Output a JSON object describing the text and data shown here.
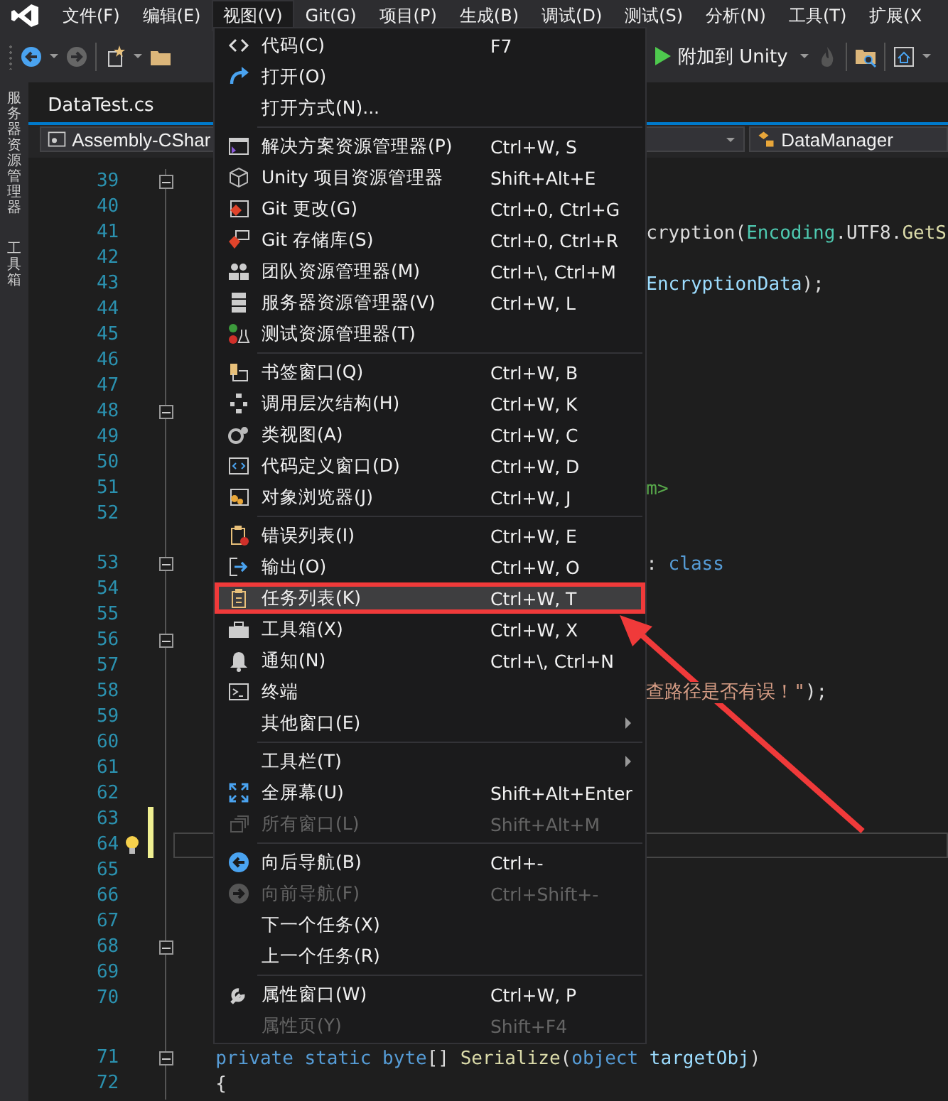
{
  "menubar": [
    {
      "label": "文件(F)",
      "selected": false
    },
    {
      "label": "编辑(E)",
      "selected": false
    },
    {
      "label": "视图(V)",
      "selected": true
    },
    {
      "label": "Git(G)",
      "selected": false
    },
    {
      "label": "项目(P)",
      "selected": false
    },
    {
      "label": "生成(B)",
      "selected": false
    },
    {
      "label": "调试(D)",
      "selected": false
    },
    {
      "label": "测试(S)",
      "selected": false
    },
    {
      "label": "分析(N)",
      "selected": false
    },
    {
      "label": "工具(T)",
      "selected": false
    },
    {
      "label": "扩展(X",
      "selected": false
    }
  ],
  "toolbar": {
    "attach_label": "附加到 Unity"
  },
  "side_tabs": [
    "服务器资源管理器",
    "工具箱"
  ],
  "tabs": [
    {
      "label": "DataTest.cs",
      "selected": true
    }
  ],
  "nav": {
    "project": "Assembly-CShar",
    "member": "DataManager"
  },
  "editor": {
    "lines": [
      {
        "kind": "blank",
        "number": "39",
        "foldable": true,
        "modified": false,
        "lightbulb": false,
        "current": false
      },
      {
        "kind": "blank",
        "number": "40",
        "foldable": false,
        "modified": false,
        "lightbulb": false,
        "current": false
      },
      {
        "kind": "clipped",
        "number": "41",
        "foldable": false,
        "modified": false,
        "lightbulb": false,
        "current": false,
        "tokens": [
          {
            "text": "cryption(",
            "kind": "plain"
          },
          {
            "text": "Encoding",
            "kind": "type"
          },
          {
            "text": ".UTF8.",
            "kind": "plain"
          },
          {
            "text": "GetS",
            "kind": "method"
          }
        ]
      },
      {
        "kind": "blank",
        "number": "42",
        "foldable": false,
        "modified": false,
        "lightbulb": false,
        "current": false
      },
      {
        "kind": "clipped",
        "number": "43",
        "foldable": false,
        "modified": false,
        "lightbulb": false,
        "current": false,
        "tokens": [
          {
            "text": "EncryptionData",
            "kind": "variable"
          },
          {
            "text": ");",
            "kind": "plain"
          }
        ]
      },
      {
        "kind": "blank",
        "number": "44",
        "foldable": false,
        "modified": false,
        "lightbulb": false,
        "current": false
      },
      {
        "kind": "blank",
        "number": "45",
        "foldable": false,
        "modified": false,
        "lightbulb": false,
        "current": false
      },
      {
        "kind": "blank",
        "number": "46",
        "foldable": false,
        "modified": false,
        "lightbulb": false,
        "current": false
      },
      {
        "kind": "blank",
        "number": "47",
        "foldable": false,
        "modified": false,
        "lightbulb": false,
        "current": false
      },
      {
        "kind": "blank",
        "number": "48",
        "foldable": true,
        "modified": false,
        "lightbulb": false,
        "current": false
      },
      {
        "kind": "blank",
        "number": "49",
        "foldable": false,
        "modified": false,
        "lightbulb": false,
        "current": false
      },
      {
        "kind": "blank",
        "number": "50",
        "foldable": false,
        "modified": false,
        "lightbulb": false,
        "current": false
      },
      {
        "kind": "clipped",
        "number": "51",
        "foldable": false,
        "modified": false,
        "lightbulb": false,
        "current": false,
        "tokens": [
          {
            "text": "m>",
            "kind": "comment"
          }
        ]
      },
      {
        "kind": "blank",
        "number": "52",
        "foldable": false,
        "modified": false,
        "lightbulb": false,
        "current": false
      },
      {
        "kind": "codelens"
      },
      {
        "kind": "clipped",
        "number": "53",
        "foldable": true,
        "modified": false,
        "lightbulb": false,
        "current": false,
        "tokens": [
          {
            "text": ": ",
            "kind": "plain"
          },
          {
            "text": "class",
            "kind": "keyword"
          }
        ]
      },
      {
        "kind": "blank",
        "number": "54",
        "foldable": false,
        "modified": false,
        "lightbulb": false,
        "current": false
      },
      {
        "kind": "blank",
        "number": "55",
        "foldable": false,
        "modified": false,
        "lightbulb": false,
        "current": false
      },
      {
        "kind": "blank",
        "number": "56",
        "foldable": true,
        "modified": false,
        "lightbulb": false,
        "current": false
      },
      {
        "kind": "blank",
        "number": "57",
        "foldable": false,
        "modified": false,
        "lightbulb": false,
        "current": false
      },
      {
        "kind": "clipped",
        "number": "58",
        "foldable": false,
        "modified": false,
        "lightbulb": false,
        "current": false,
        "tokens": [
          {
            "text": "查路径是否有误！\"",
            "kind": "string"
          },
          {
            "text": ");",
            "kind": "plain"
          }
        ]
      },
      {
        "kind": "blank",
        "number": "59",
        "foldable": false,
        "modified": false,
        "lightbulb": false,
        "current": false
      },
      {
        "kind": "blank",
        "number": "60",
        "foldable": false,
        "modified": false,
        "lightbulb": false,
        "current": false
      },
      {
        "kind": "blank",
        "number": "61",
        "foldable": false,
        "modified": false,
        "lightbulb": false,
        "current": false
      },
      {
        "kind": "blank",
        "number": "62",
        "foldable": false,
        "modified": false,
        "lightbulb": false,
        "current": false
      },
      {
        "kind": "blank",
        "number": "63",
        "foldable": false,
        "modified": true,
        "lightbulb": false,
        "current": false
      },
      {
        "kind": "blank",
        "number": "64",
        "foldable": false,
        "modified": true,
        "lightbulb": true,
        "current": true
      },
      {
        "kind": "blank",
        "number": "65",
        "foldable": false,
        "modified": false,
        "lightbulb": false,
        "current": false
      },
      {
        "kind": "blank",
        "number": "66",
        "foldable": false,
        "modified": false,
        "lightbulb": false,
        "current": false
      },
      {
        "kind": "blank",
        "number": "67",
        "foldable": false,
        "modified": false,
        "lightbulb": false,
        "current": false
      },
      {
        "kind": "blank",
        "number": "68",
        "foldable": true,
        "modified": false,
        "lightbulb": false,
        "current": false
      },
      {
        "kind": "blank",
        "number": "69",
        "foldable": false,
        "modified": false,
        "lightbulb": false,
        "current": false
      },
      {
        "kind": "blank",
        "number": "70",
        "foldable": false,
        "modified": false,
        "lightbulb": false,
        "current": false
      },
      {
        "kind": "codelens"
      },
      {
        "kind": "full",
        "number": "71",
        "foldable": true,
        "modified": false,
        "lightbulb": false,
        "current": false,
        "tokens": [
          {
            "text": "private static ",
            "kind": "keyword"
          },
          {
            "text": "byte",
            "kind": "keyword"
          },
          {
            "text": "[] ",
            "kind": "plain"
          },
          {
            "text": "Serialize",
            "kind": "method"
          },
          {
            "text": "(",
            "kind": "plain"
          },
          {
            "text": "object ",
            "kind": "keyword"
          },
          {
            "text": "targetObj",
            "kind": "variable"
          },
          {
            "text": ")",
            "kind": "plain"
          }
        ]
      },
      {
        "kind": "full",
        "number": "72",
        "foldable": false,
        "modified": false,
        "lightbulb": false,
        "current": false,
        "tokens": [
          {
            "text": "{",
            "kind": "plain"
          }
        ]
      }
    ]
  },
  "view_menu": {
    "groups": [
      {
        "items": [
          {
            "label": "代码(C)",
            "shortcut": "F7",
            "selected": false,
            "disabled": false,
            "submenu": false
          },
          {
            "label": "打开(O)",
            "selected": false,
            "disabled": false,
            "submenu": false
          },
          {
            "label": "打开方式(N)...",
            "selected": false,
            "disabled": false,
            "submenu": false
          }
        ]
      },
      {
        "items": [
          {
            "label": "解决方案资源管理器(P)",
            "shortcut": "Ctrl+W, S",
            "selected": false,
            "disabled": false,
            "submenu": false
          },
          {
            "label": "Unity 项目资源管理器",
            "shortcut": "Shift+Alt+E",
            "selected": false,
            "disabled": false,
            "submenu": false
          },
          {
            "label": "Git 更改(G)",
            "shortcut": "Ctrl+0, Ctrl+G",
            "selected": false,
            "disabled": false,
            "submenu": false
          },
          {
            "label": "Git 存储库(S)",
            "shortcut": "Ctrl+0, Ctrl+R",
            "selected": false,
            "disabled": false,
            "submenu": false
          },
          {
            "label": "团队资源管理器(M)",
            "shortcut": "Ctrl+\\, Ctrl+M",
            "selected": false,
            "disabled": false,
            "submenu": false
          },
          {
            "label": "服务器资源管理器(V)",
            "shortcut": "Ctrl+W, L",
            "selected": false,
            "disabled": false,
            "submenu": false
          },
          {
            "label": "测试资源管理器(T)",
            "selected": false,
            "disabled": false,
            "submenu": false
          }
        ]
      },
      {
        "items": [
          {
            "label": "书签窗口(Q)",
            "shortcut": "Ctrl+W, B",
            "selected": false,
            "disabled": false,
            "submenu": false
          },
          {
            "label": "调用层次结构(H)",
            "shortcut": "Ctrl+W, K",
            "selected": false,
            "disabled": false,
            "submenu": false
          },
          {
            "label": "类视图(A)",
            "shortcut": "Ctrl+W, C",
            "selected": false,
            "disabled": false,
            "submenu": false
          },
          {
            "label": "代码定义窗口(D)",
            "shortcut": "Ctrl+W, D",
            "selected": false,
            "disabled": false,
            "submenu": false
          },
          {
            "label": "对象浏览器(J)",
            "shortcut": "Ctrl+W, J",
            "selected": false,
            "disabled": false,
            "submenu": false
          }
        ]
      },
      {
        "items": [
          {
            "label": "错误列表(I)",
            "shortcut": "Ctrl+W, E",
            "selected": false,
            "disabled": false,
            "submenu": false
          },
          {
            "label": "输出(O)",
            "shortcut": "Ctrl+W, O",
            "selected": false,
            "disabled": false,
            "submenu": false
          },
          {
            "label": "任务列表(K)",
            "shortcut": "Ctrl+W, T",
            "selected": true,
            "disabled": false,
            "submenu": false
          },
          {
            "label": "工具箱(X)",
            "shortcut": "Ctrl+W, X",
            "selected": false,
            "disabled": false,
            "submenu": false
          },
          {
            "label": "通知(N)",
            "shortcut": "Ctrl+\\, Ctrl+N",
            "selected": false,
            "disabled": false,
            "submenu": false
          },
          {
            "label": "终端",
            "selected": false,
            "disabled": false,
            "submenu": false
          },
          {
            "label": "其他窗口(E)",
            "selected": false,
            "disabled": false,
            "submenu": true
          }
        ]
      },
      {
        "items": [
          {
            "label": "工具栏(T)",
            "selected": false,
            "disabled": false,
            "submenu": true
          },
          {
            "label": "全屏幕(U)",
            "shortcut": "Shift+Alt+Enter",
            "selected": false,
            "disabled": false,
            "submenu": false
          },
          {
            "label": "所有窗口(L)",
            "shortcut": "Shift+Alt+M",
            "selected": false,
            "disabled": true,
            "submenu": false
          }
        ]
      },
      {
        "items": [
          {
            "label": "向后导航(B)",
            "shortcut": "Ctrl+-",
            "selected": false,
            "disabled": false,
            "submenu": false
          },
          {
            "label": "向前导航(F)",
            "shortcut": "Ctrl+Shift+-",
            "selected": false,
            "disabled": true,
            "submenu": false
          },
          {
            "label": "下一个任务(X)",
            "selected": false,
            "disabled": false,
            "submenu": false
          },
          {
            "label": "上一个任务(R)",
            "selected": false,
            "disabled": false,
            "submenu": false
          }
        ]
      },
      {
        "items": [
          {
            "label": "属性窗口(W)",
            "shortcut": "Ctrl+W, P",
            "selected": false,
            "disabled": false,
            "submenu": false
          },
          {
            "label": "属性页(Y)",
            "shortcut": "Shift+F4",
            "selected": false,
            "disabled": true,
            "submenu": false
          }
        ]
      }
    ]
  },
  "annotations": {
    "frame": true,
    "arrow": true
  }
}
